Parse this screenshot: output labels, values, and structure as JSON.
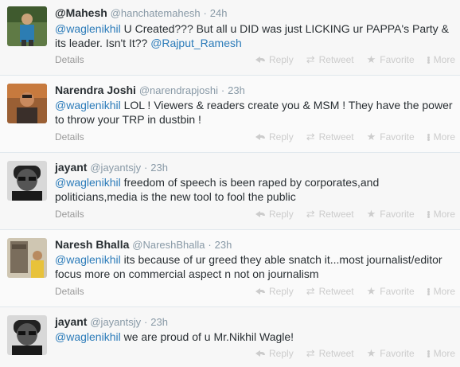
{
  "actions": {
    "details": "Details",
    "reply": "Reply",
    "retweet": "Retweet",
    "favorite": "Favorite",
    "more": "More"
  },
  "tweets": [
    {
      "name": "@Mahesh",
      "handle": "@hanchatemahesh",
      "time": "24h",
      "text_parts": [
        "@waglenikhil",
        " U Created??? But all u DID was just LICKING ur PAPPA's Party & its leader. Isn't It?? ",
        "@Rajput_Ramesh"
      ],
      "avatar_colors": [
        "#4a6a3a",
        "#2c7db3",
        "#e8e0c8"
      ]
    },
    {
      "name": "Narendra Joshi",
      "handle": "@narendrapjoshi",
      "time": "23h",
      "text_parts": [
        "@waglenikhil",
        " LOL ! Viewers & readers create you & MSM ! They have the power to throw your TRP in dustbin !"
      ],
      "avatar_colors": [
        "#b06a3a",
        "#3a2f2a",
        "#c98a5e"
      ]
    },
    {
      "name": "jayant",
      "handle": "@jayantsjy",
      "time": "23h",
      "text_parts": [
        "@waglenikhil",
        " freedom of speech is been raped  by corporates,and politicians,media is the new tool to fool the public"
      ],
      "avatar_colors": [
        "#222222",
        "#777777",
        "#bbbbbb"
      ]
    },
    {
      "name": "Naresh Bhalla",
      "handle": "@NareshBhalla",
      "time": "23h",
      "text_parts": [
        "@waglenikhil",
        " its because of ur greed they able snatch it...most journalist/editor focus more on commercial aspect n not on journalism"
      ],
      "avatar_colors": [
        "#8a7d6a",
        "#e8c23a",
        "#5a4a3a"
      ]
    },
    {
      "name": "jayant",
      "handle": "@jayantsjy",
      "time": "23h",
      "text_parts": [
        "@waglenikhil",
        " we are proud of u Mr.Nikhil Wagle!"
      ],
      "avatar_colors": [
        "#222222",
        "#777777",
        "#bbbbbb"
      ]
    }
  ]
}
